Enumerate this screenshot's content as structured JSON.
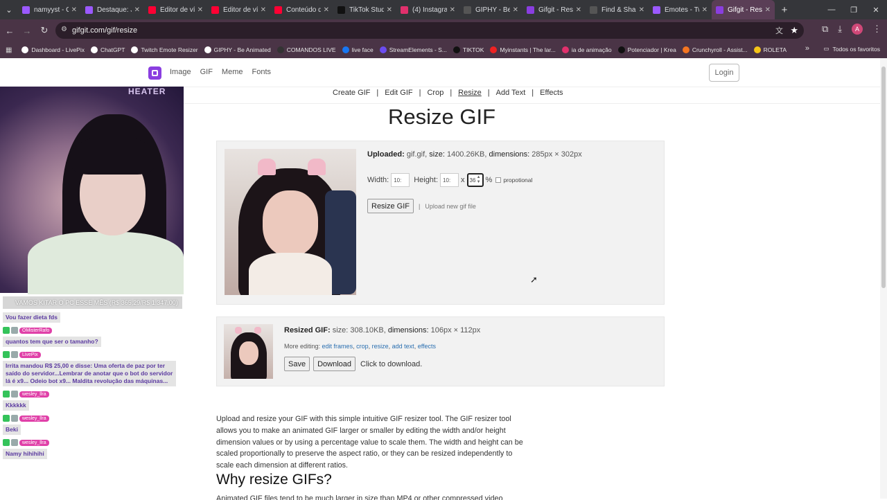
{
  "browser": {
    "tabs": [
      {
        "title": "namyyst - Gi",
        "color": "#9b59ff"
      },
      {
        "title": "Destaque: J",
        "color": "#9b59ff"
      },
      {
        "title": "Editor de víd",
        "color": "#ff0033"
      },
      {
        "title": "Editor de víd",
        "color": "#ff0033"
      },
      {
        "title": "Conteúdo d",
        "color": "#ff0033"
      },
      {
        "title": "TikTok Studi",
        "color": "#111111"
      },
      {
        "title": "(4) Instagram",
        "color": "#e1306c"
      },
      {
        "title": "GIPHY - Be A",
        "color": "#555555"
      },
      {
        "title": "Gifgit - Resi",
        "color": "#8a3ee0"
      },
      {
        "title": "Find & Sha",
        "color": "#555555"
      },
      {
        "title": "Emotes - Tw",
        "color": "#9b59ff"
      },
      {
        "title": "Gifgit - Resiz",
        "color": "#8a3ee0",
        "active": true
      }
    ],
    "url": "gifgit.com/gif/resize",
    "bookmarks": [
      {
        "label": "Dashboard - LivePix",
        "color": "#ffffff"
      },
      {
        "label": "ChatGPT",
        "color": "#ffffff"
      },
      {
        "label": "Twitch Emote Resizer",
        "color": "#ffffff"
      },
      {
        "label": "GIPHY - Be Animated",
        "color": "#ffffff"
      },
      {
        "label": "COMANDOS LIVE",
        "color": "#333333"
      },
      {
        "label": "live face",
        "color": "#1877f2"
      },
      {
        "label": "StreamElements - S...",
        "color": "#6b4cf0"
      },
      {
        "label": "TIKTOK",
        "color": "#111111"
      },
      {
        "label": "Myinstants | The lar...",
        "color": "#e22"
      },
      {
        "label": "ia de animação",
        "color": "#e1306c"
      },
      {
        "label": "Potenciador | Krea",
        "color": "#111111"
      },
      {
        "label": "Crunchyroll - Assist...",
        "color": "#f47521"
      },
      {
        "label": "ROLETA",
        "color": "#f5c518"
      }
    ],
    "all_favorites": "Todos os favoritos",
    "profile_letter": "A"
  },
  "site": {
    "nav": [
      "Image",
      "GIF",
      "Meme",
      "Fonts"
    ],
    "login": "Login",
    "subnav": [
      "Create GIF",
      "Edit GIF",
      "Crop",
      "Resize",
      "Add Text",
      "Effects"
    ],
    "subnav_current": "Resize",
    "title": "Resize GIF",
    "uploaded": {
      "label": "Uploaded:",
      "filename": "gif.gif",
      "size_label": "size:",
      "size_value": "1400.26KB",
      "dim_label": "dimensions:",
      "dim_value": "285px × 302px"
    },
    "resize_form": {
      "width_label": "Width:",
      "width_value": "10:",
      "height_label": "Height:",
      "height_value": "10:",
      "x": "x",
      "percent_value": "36",
      "percent_sign": "%",
      "proportional_label": "propotional",
      "resize_button": "Resize GIF",
      "separator": "|",
      "upload_new": "Upload new gif file"
    },
    "resized": {
      "label": "Resized GIF:",
      "size_label": "size:",
      "size_value": "308.10KB",
      "dim_label": "dimensions:",
      "dim_value": "106px × 112px",
      "more_label": "More editing:",
      "links": [
        "edit frames",
        "crop",
        "resize",
        "add text",
        "effects"
      ],
      "save": "Save",
      "download": "Download",
      "hint": "Click to download."
    },
    "paragraph": "Upload and resize your GIF with this simple intuitive GIF resizer tool. The GIF resizer tool allows you to make an animated GIF larger or smaller by editing the width and/or height dimension values or by using a percentage value to scale them. The width and height can be scaled proportionally to preserve the aspect ratio, or they can be resized independently to scale each dimension at different ratios.",
    "h2": "Why resize GIFs?",
    "paragraph2": "Animated GIF files tend to be much larger in size than MP4 or other compressed video formats"
  },
  "stream_overlay": {
    "cam_brand": "HEATER",
    "goal": "VAMOS KITAR O PC ESSE MÊS (R$ 365,29/R$ 1.347,00)",
    "messages": [
      {
        "user": "",
        "text": "Vou fazer dieta fds"
      },
      {
        "user": "OMisterRafo",
        "text": "quantos tem que ser o tamanho?"
      },
      {
        "user": "LivePix",
        "text": "Irrita mandou R$ 25,00 e disse: Uma oferta de paz por ter saído do servidor...Lembrar de anotar que o bot do servidor lá é x9... Odeio bot x9... Maldita revolução das máquinas..."
      },
      {
        "user": "wesley_llra",
        "text": "Kkkkkk"
      },
      {
        "user": "wesley_llra",
        "text": "Beki"
      },
      {
        "user": "wesley_llra",
        "text": "Namy hihihihi"
      }
    ]
  }
}
